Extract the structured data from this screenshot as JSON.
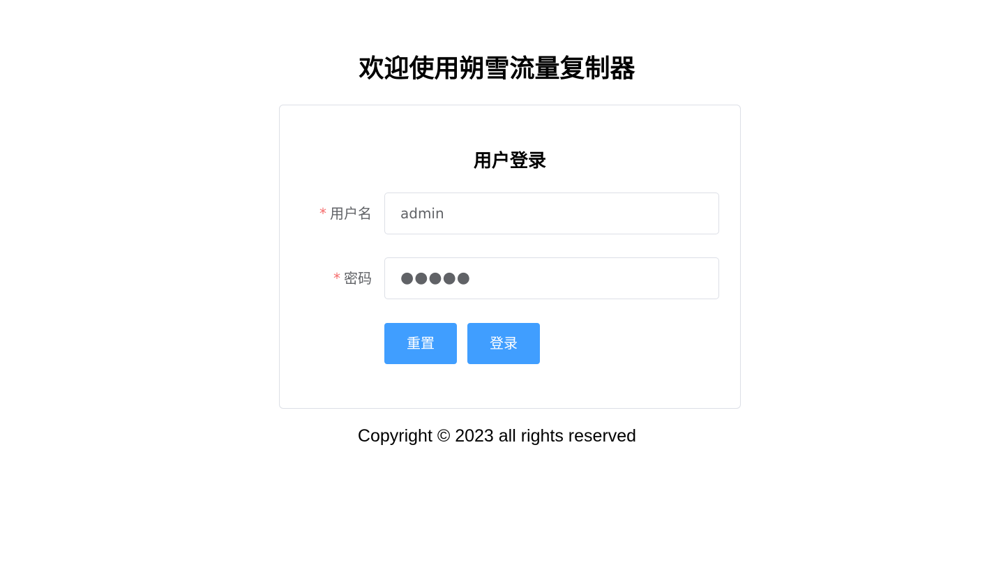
{
  "page": {
    "title": "欢迎使用朔雪流量复制器",
    "copyright": "Copyright © 2023 all rights reserved"
  },
  "login_form": {
    "title": "用户登录",
    "required_mark": "*",
    "username": {
      "label": "用户名",
      "value": "admin"
    },
    "password": {
      "label": "密码",
      "masked_value": "●●●●●"
    },
    "reset_label": "重置",
    "login_label": "登录"
  },
  "colors": {
    "primary_button": "#409eff",
    "required_mark": "#f56c6c",
    "border": "#dcdfe6"
  }
}
